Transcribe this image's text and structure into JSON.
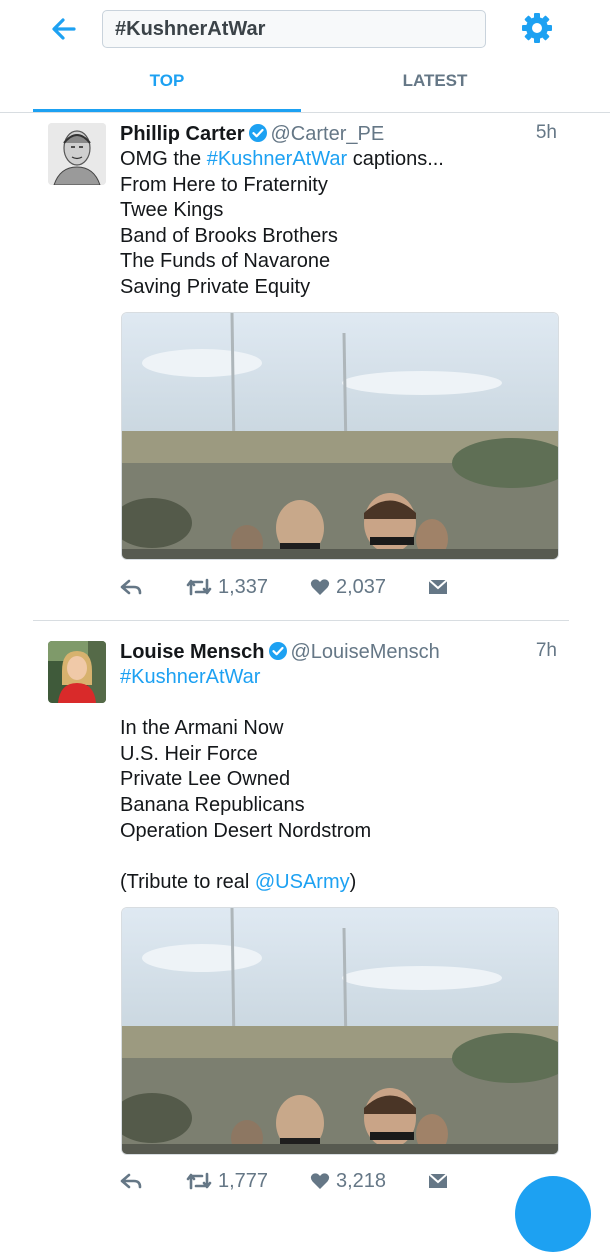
{
  "header": {
    "search_value": "#KushnerAtWar",
    "tabs": [
      {
        "label": "TOP",
        "active": true
      },
      {
        "label": "LATEST",
        "active": false
      }
    ],
    "icons": [
      "back-arrow-icon",
      "gear-icon"
    ],
    "accent": "#1da1f2"
  },
  "tweets": [
    {
      "name": "Phillip Carter",
      "handle": "@Carter_PE",
      "time": "5h",
      "verified": true,
      "lines": [
        {
          "pre": "OMG the ",
          "link": "#KushnerAtWar",
          "post": " captions..."
        },
        {
          "pre": "From Here to Fraternity"
        },
        {
          "pre": "Twee Kings"
        },
        {
          "pre": "Band of Brooks Brothers"
        },
        {
          "pre": "The Funds of Navarone"
        },
        {
          "pre": "Saving Private Equity"
        }
      ],
      "retweets": "1,337",
      "likes": "2,037"
    },
    {
      "name": "Louise Mensch",
      "handle": "@LouiseMensch",
      "time": "7h",
      "verified": true,
      "lines": [
        {
          "pre": "",
          "link": "#KushnerAtWar",
          "post": ""
        },
        {
          "pre": ""
        },
        {
          "pre": "In the Armani Now"
        },
        {
          "pre": "U.S. Heir Force"
        },
        {
          "pre": "Private Lee Owned"
        },
        {
          "pre": "Banana Republicans"
        },
        {
          "pre": "Operation Desert Nordstrom"
        },
        {
          "pre": ""
        },
        {
          "pre": "(Tribute to real ",
          "link": "@USArmy",
          "post": ")"
        }
      ],
      "retweets": "1,777",
      "likes": "3,218"
    }
  ]
}
